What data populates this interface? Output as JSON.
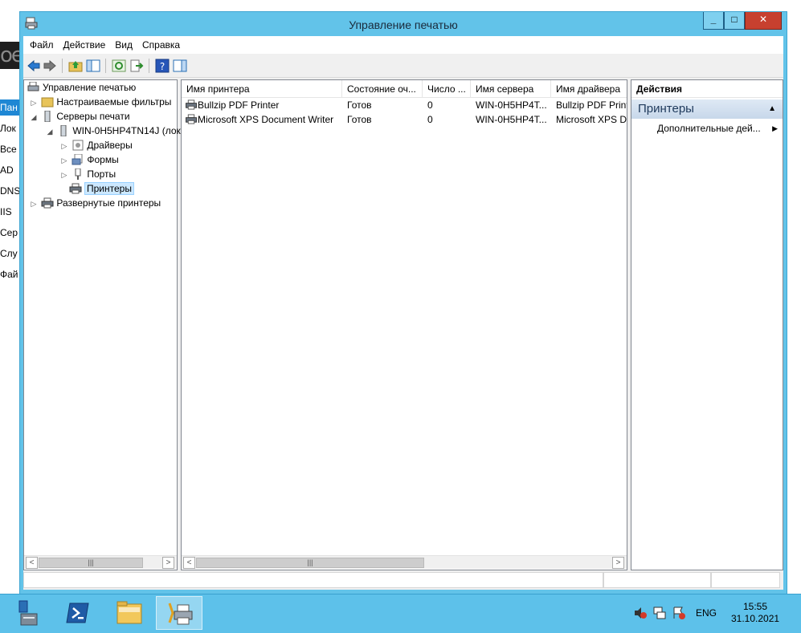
{
  "background": {
    "logo_text": "ое",
    "items": [
      "Пан",
      "Лок",
      "Все",
      "AD",
      "DNS",
      "IIS",
      "Сер",
      "Слу",
      "Фай"
    ],
    "active_index": 0
  },
  "window": {
    "title": "Управление печатью",
    "controls": {
      "minimize": "_",
      "maximize": "□",
      "close": "✕"
    }
  },
  "menu": {
    "items": [
      "Файл",
      "Действие",
      "Вид",
      "Справка"
    ]
  },
  "toolbar": {
    "icons": [
      "back-icon",
      "forward-icon",
      "up-folder-icon",
      "show-hide-tree-icon",
      "refresh-icon",
      "export-list-icon",
      "help-icon",
      "show-hide-action-pane-icon"
    ]
  },
  "tree": {
    "root": "Управление печатью",
    "items": [
      {
        "label": "Настраиваемые фильтры",
        "icon": "filter-folder-icon"
      },
      {
        "label": "Серверы печати",
        "icon": "server-icon"
      },
      {
        "label": "WIN-0H5HP4TN14J (лок",
        "icon": "server-icon"
      },
      {
        "label": "Драйверы",
        "icon": "driver-icon"
      },
      {
        "label": "Формы",
        "icon": "forms-icon"
      },
      {
        "label": "Порты",
        "icon": "port-icon"
      },
      {
        "label": "Принтеры",
        "icon": "printer-icon"
      },
      {
        "label": "Развернутые принтеры",
        "icon": "printer-icon"
      }
    ],
    "scroll_thumb": "|||",
    "scroll_left": "<",
    "scroll_right": ">"
  },
  "list": {
    "columns": [
      "Имя принтера",
      "Состояние оч...",
      "Число ...",
      "Имя сервера",
      "Имя драйвера"
    ],
    "rows": [
      {
        "name": "Bullzip PDF Printer",
        "status": "Готов",
        "jobs": "0",
        "server": "WIN-0H5HP4T...",
        "driver": "Bullzip PDF Print"
      },
      {
        "name": "Microsoft XPS Document Writer",
        "status": "Готов",
        "jobs": "0",
        "server": "WIN-0H5HP4T...",
        "driver": "Microsoft XPS Do"
      }
    ],
    "scroll_thumb": "|||",
    "scroll_left": "<",
    "scroll_right": ">"
  },
  "actions": {
    "header": "Действия",
    "section": "Принтеры",
    "items": [
      {
        "label": "Дополнительные дей..."
      }
    ]
  },
  "taskbar": {
    "apps": [
      "server-manager-icon",
      "powershell-icon",
      "file-explorer-icon",
      "print-management-icon"
    ],
    "active_app": 3,
    "tray": {
      "language": "ENG",
      "time": "15:55",
      "date": "31.10.2021"
    }
  }
}
